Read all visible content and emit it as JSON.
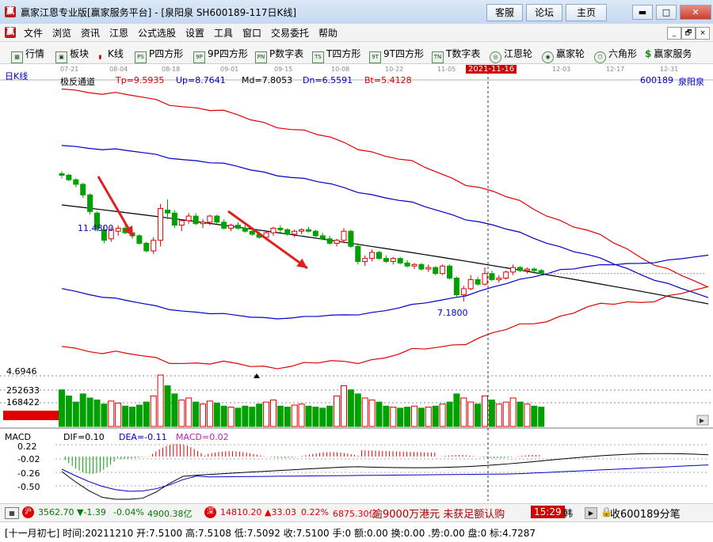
{
  "window": {
    "title": "赢家江恩专业版[赢家服务平台] - [泉阳泉  SH600189-117日K线]",
    "buttons": [
      "客服",
      "论坛",
      "主页"
    ],
    "controls": [
      "▬",
      "□",
      "✕"
    ]
  },
  "menu": [
    "文件",
    "浏览",
    "资讯",
    "江恩",
    "公式选股",
    "设置",
    "工具",
    "窗口",
    "交易委托",
    "帮助"
  ],
  "mdi_controls": [
    "_",
    "🗗",
    "×"
  ],
  "toolbar": [
    {
      "label": "行情",
      "icon": "grid-icon"
    },
    {
      "label": "板块",
      "icon": "blocks-icon"
    },
    {
      "label": "K线",
      "icon": "candlestick-icon"
    },
    {
      "label": "P四方形",
      "icon": "ps-icon",
      "badge": "PS"
    },
    {
      "label": "9P四方形",
      "icon": "9p-icon",
      "badge": "9P"
    },
    {
      "label": "P数字表",
      "icon": "pn-icon",
      "badge": "PN"
    },
    {
      "label": "T四方形",
      "icon": "ts-icon",
      "badge": "TS"
    },
    {
      "label": "9T四方形",
      "icon": "9t-icon",
      "badge": "9T"
    },
    {
      "label": "T数字表",
      "icon": "tn-icon",
      "badge": "TN"
    },
    {
      "label": "江恩轮",
      "icon": "gann-wheel-icon"
    },
    {
      "label": "赢家轮",
      "icon": "winner-wheel-icon"
    },
    {
      "label": "六角形",
      "icon": "hexagon-icon"
    },
    {
      "label": "赢家服务",
      "icon": "dollar-icon"
    }
  ],
  "chart": {
    "period_label": "日K线",
    "indicator_name": "极反通道",
    "tp": "Tp=9.5935",
    "up": "Up=8.7641",
    "md": "Md=7.8053",
    "dn": "Dn=6.5591",
    "bt": "Bt=5.4128",
    "stock_code": "600189",
    "stock_name": "泉阳泉",
    "date_ticks": [
      "07-21",
      "08-04",
      "08-18",
      "09-01",
      "09-15",
      "10-08",
      "10-22",
      "11-05",
      "12-03",
      "12-17",
      "12-31"
    ],
    "cursor_date": "2021-11-16",
    "high_label": "11.4800",
    "low_label": "7.1800",
    "price_axis_label": "4.6946",
    "volume_labels": [
      "252633",
      "168422"
    ],
    "macd": {
      "name": "MACD",
      "dif": "DIF=0.10",
      "dea": "DEA=-0.11",
      "macd": "MACD=0.02",
      "axis": [
        "0.22",
        "-0.02",
        "-0.26",
        "-0.50"
      ]
    }
  },
  "chart_data": {
    "type": "candlestick",
    "title": "泉阳泉 SH600189 日K线",
    "candles": [
      [
        11.4,
        11.48,
        11.25,
        11.35
      ],
      [
        11.35,
        11.4,
        11.15,
        11.2
      ],
      [
        11.2,
        11.25,
        10.95,
        11.05
      ],
      [
        11.05,
        11.1,
        10.6,
        10.7
      ],
      [
        10.7,
        10.75,
        10.05,
        10.15
      ],
      [
        10.1,
        10.15,
        9.5,
        9.6
      ],
      [
        9.55,
        9.7,
        9.1,
        9.2
      ],
      [
        9.25,
        9.65,
        9.15,
        9.55
      ],
      [
        9.5,
        9.7,
        9.35,
        9.6
      ],
      [
        9.6,
        9.8,
        9.4,
        9.45
      ],
      [
        9.45,
        9.55,
        9.25,
        9.35
      ],
      [
        9.35,
        9.4,
        9.05,
        9.1
      ],
      [
        9.1,
        9.15,
        8.8,
        8.85
      ],
      [
        8.85,
        9.3,
        8.75,
        9.2
      ],
      [
        9.2,
        10.4,
        9.0,
        10.25
      ],
      [
        10.2,
        10.55,
        9.9,
        10.1
      ],
      [
        10.1,
        10.2,
        9.6,
        9.7
      ],
      [
        9.7,
        9.9,
        9.5,
        9.85
      ],
      [
        9.85,
        10.1,
        9.75,
        10.0
      ],
      [
        10.0,
        10.1,
        9.7,
        9.75
      ],
      [
        9.75,
        9.9,
        9.6,
        9.8
      ],
      [
        9.8,
        10.05,
        9.7,
        10.0
      ],
      [
        10.0,
        10.05,
        9.75,
        9.8
      ],
      [
        9.8,
        9.9,
        9.55,
        9.6
      ],
      [
        9.6,
        9.75,
        9.5,
        9.7
      ],
      [
        9.7,
        9.8,
        9.55,
        9.6
      ],
      [
        9.6,
        9.7,
        9.45,
        9.5
      ],
      [
        9.5,
        9.6,
        9.35,
        9.4
      ],
      [
        9.4,
        9.5,
        9.25,
        9.3
      ],
      [
        9.3,
        9.5,
        9.2,
        9.45
      ],
      [
        9.45,
        9.65,
        9.35,
        9.6
      ],
      [
        9.6,
        9.7,
        9.45,
        9.55
      ],
      [
        9.55,
        9.6,
        9.35,
        9.4
      ],
      [
        9.4,
        9.55,
        9.3,
        9.5
      ],
      [
        9.5,
        9.6,
        9.4,
        9.55
      ],
      [
        9.55,
        9.65,
        9.45,
        9.5
      ],
      [
        9.5,
        9.55,
        9.3,
        9.35
      ],
      [
        9.35,
        9.45,
        9.2,
        9.25
      ],
      [
        9.25,
        9.35,
        9.05,
        9.1
      ],
      [
        9.1,
        9.25,
        9.0,
        9.2
      ],
      [
        9.2,
        9.6,
        9.1,
        9.5
      ],
      [
        9.5,
        9.55,
        8.95,
        9.0
      ],
      [
        9.0,
        9.1,
        8.4,
        8.5
      ],
      [
        8.5,
        8.7,
        8.35,
        8.6
      ],
      [
        8.6,
        8.9,
        8.5,
        8.8
      ],
      [
        8.8,
        8.85,
        8.55,
        8.6
      ],
      [
        8.6,
        8.7,
        8.45,
        8.5
      ],
      [
        8.5,
        8.65,
        8.4,
        8.6
      ],
      [
        8.6,
        8.65,
        8.4,
        8.45
      ],
      [
        8.45,
        8.55,
        8.3,
        8.35
      ],
      [
        8.35,
        8.45,
        8.25,
        8.4
      ],
      [
        8.4,
        8.45,
        8.2,
        8.25
      ],
      [
        8.25,
        8.4,
        8.15,
        8.3
      ],
      [
        8.3,
        8.35,
        8.05,
        8.1
      ],
      [
        8.1,
        8.4,
        8.05,
        8.35
      ],
      [
        8.35,
        8.4,
        7.9,
        7.95
      ],
      [
        7.95,
        8.0,
        7.3,
        7.4
      ],
      [
        7.4,
        7.7,
        7.18,
        7.6
      ],
      [
        7.6,
        8.05,
        7.55,
        7.9
      ],
      [
        7.9,
        8.0,
        7.7,
        7.75
      ],
      [
        7.75,
        8.3,
        7.7,
        8.1
      ],
      [
        8.1,
        8.2,
        7.85,
        7.9
      ],
      [
        7.9,
        8.05,
        7.8,
        7.95
      ],
      [
        7.95,
        8.2,
        7.9,
        8.15
      ],
      [
        8.15,
        8.4,
        8.05,
        8.3
      ],
      [
        8.3,
        8.35,
        8.15,
        8.2
      ],
      [
        8.2,
        8.3,
        8.1,
        8.25
      ],
      [
        8.25,
        8.3,
        8.1,
        8.2
      ],
      [
        8.2,
        8.25,
        8.05,
        8.1
      ]
    ],
    "volume": [
      180000,
      150000,
      120000,
      160000,
      140000,
      130000,
      110000,
      125000,
      115000,
      100000,
      95000,
      105000,
      120000,
      150000,
      252633,
      200000,
      160000,
      130000,
      140000,
      120000,
      110000,
      125000,
      115000,
      100000,
      95000,
      90000,
      100000,
      95000,
      110000,
      120000,
      130000,
      100000,
      95000,
      105000,
      110000,
      100000,
      95000,
      90000,
      100000,
      150000,
      200000,
      180000,
      160000,
      140000,
      130000,
      120000,
      100000,
      95000,
      90000,
      95000,
      100000,
      90000,
      95000,
      100000,
      110000,
      120000,
      160000,
      140000,
      120000,
      110000,
      150000,
      130000,
      110000,
      120000,
      140000,
      120000,
      110000,
      100000,
      95000
    ],
    "channels": [
      "Tp",
      "Up",
      "Md",
      "Dn",
      "Bt"
    ],
    "ylim": [
      4.6946,
      14.5
    ]
  },
  "status1": {
    "sh_index": "3562.70",
    "sh_change": "▼-1.39",
    "sh_pct": "-0.04%",
    "sh_amount": "4900.38亿",
    "sz_index": "14810.20",
    "sz_change": "▲33.03",
    "sz_pct": "0.22%",
    "sz_amount": "6875.30亿",
    "ticker_text": "逾9000万港元 未获足额认购",
    "time": "15:29",
    "extra": "韩",
    "collect": "收600189分笔"
  },
  "status2": {
    "text": "[十一月初七] 时间:20211210 开:7.5100 高:7.5108 低:7.5092 收:7.5100 手:0 额:0.00 换:0.00 .势:0.00 盘:0 标:4.7287"
  },
  "colors": {
    "up": "#e00000",
    "down": "#00a000",
    "channel_outer": "#e00000",
    "channel_inner": "#0000c8",
    "middle": "#000000",
    "arrow": "#e02020"
  }
}
